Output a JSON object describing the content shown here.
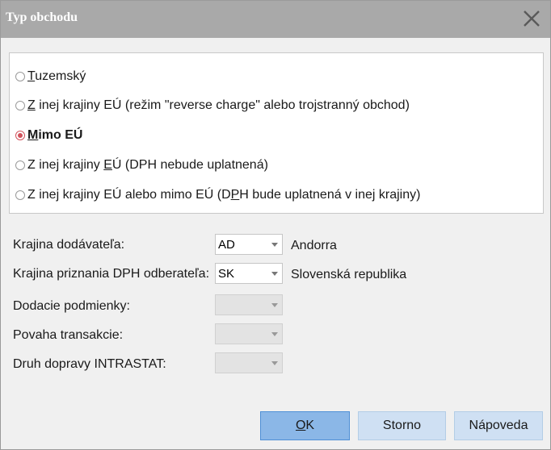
{
  "window": {
    "title": "Typ obchodu"
  },
  "icons": {
    "close": "close-icon"
  },
  "trade_type": {
    "options": [
      {
        "pre": "",
        "u": "T",
        "post": "uzemský",
        "checked": false
      },
      {
        "pre": "",
        "u": "Z",
        "post": " inej krajiny EÚ (režim \"reverse charge\" alebo trojstranný obchod)",
        "checked": false
      },
      {
        "pre": "",
        "u": "M",
        "post": "imo EÚ",
        "checked": true
      },
      {
        "pre": "Z inej krajiny ",
        "u": "E",
        "post": "Ú (DPH nebude uplatnená)",
        "checked": false
      },
      {
        "pre": "Z inej krajiny EÚ alebo mimo EÚ (D",
        "u": "P",
        "post": "H bude uplatnená v inej krajiny)",
        "checked": false
      }
    ]
  },
  "fields": {
    "supplier_country": {
      "label": "Krajina dodávateľa:",
      "value": "AD",
      "country_name": "Andorra"
    },
    "vat_country": {
      "label": "Krajina priznania DPH odberateľa:",
      "value": "SK",
      "country_name": "Slovenská republika"
    },
    "delivery_terms": {
      "label": "Dodacie podmienky:",
      "value": ""
    },
    "transaction_nature": {
      "label": "Povaha transakcie:",
      "value": ""
    },
    "transport_mode": {
      "label": "Druh dopravy INTRASTAT:",
      "value": ""
    }
  },
  "buttons": {
    "ok": {
      "u": "O",
      "post": "K"
    },
    "cancel": "Storno",
    "help": "Nápoveda"
  },
  "colors": {
    "titlebar": "#a9a9a9",
    "radio_selected": "#d2525c",
    "button": "#cfe0f3",
    "button_primary": "#8bb7e7"
  }
}
